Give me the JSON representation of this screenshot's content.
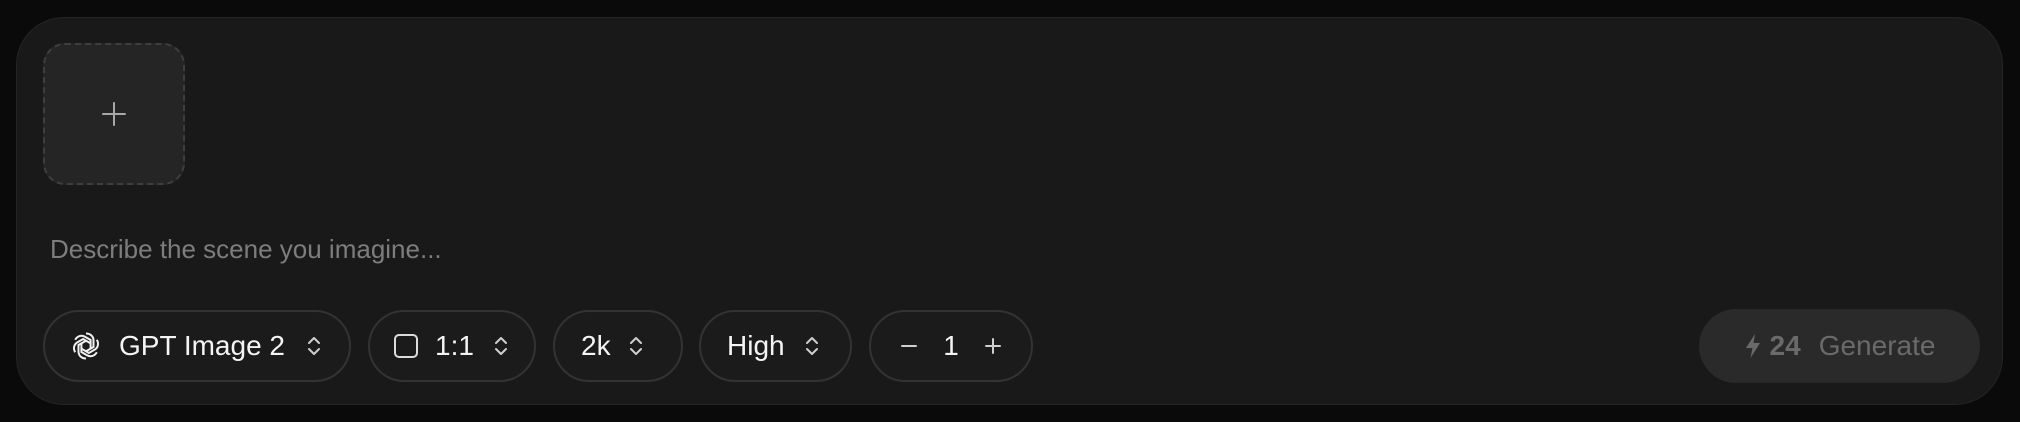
{
  "composer": {
    "prompt_placeholder": "Describe the scene you imagine...",
    "prompt_value": ""
  },
  "upload": {
    "icon": "plus-icon"
  },
  "model": {
    "label": "GPT Image 2",
    "icon": "openai-logo-icon"
  },
  "aspect_ratio": {
    "label": "1:1",
    "icon": "square-icon"
  },
  "resolution": {
    "label": "2k"
  },
  "quality": {
    "label": "High"
  },
  "count": {
    "value": "1"
  },
  "generate": {
    "credits": "24",
    "label": "Generate",
    "icon": "lightning-bolt-icon"
  },
  "colors": {
    "background": "#0a0a0a",
    "panel": "#191919",
    "pill_border": "#333333",
    "generate_bg": "#2a2a2a",
    "generate_text": "#6a6a6a"
  }
}
